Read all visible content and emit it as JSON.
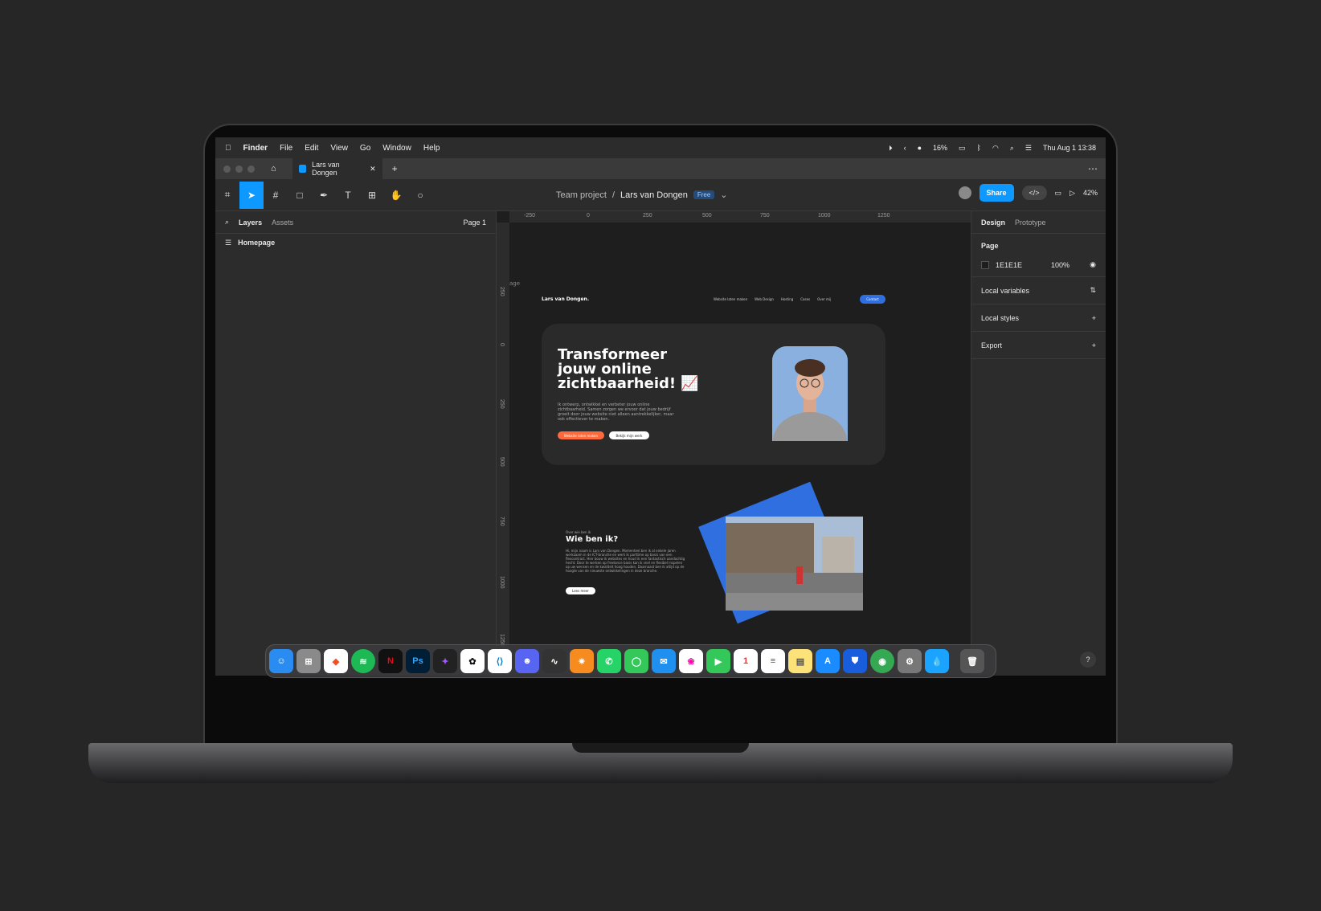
{
  "menubar": {
    "items": [
      "Finder",
      "File",
      "Edit",
      "View",
      "Go",
      "Window",
      "Help"
    ],
    "battery": "16%",
    "datetime": "Thu Aug 1  13:38"
  },
  "tabbar": {
    "tab_title": "Lars van Dongen"
  },
  "toolbar": {
    "team": "Team project",
    "file": "Lars van Dongen",
    "plan": "Free",
    "share": "Share",
    "zoom": "42%"
  },
  "left": {
    "tab_layers": "Layers",
    "tab_assets": "Assets",
    "page": "Page 1",
    "layer": "Homepage"
  },
  "right": {
    "tab_design": "Design",
    "tab_prototype": "Prototype",
    "page_label": "Page",
    "page_color": "1E1E1E",
    "page_opacity": "100%",
    "local_variables": "Local variables",
    "local_styles": "Local styles",
    "export": "Export"
  },
  "rulers": {
    "h": [
      "-250",
      "0",
      "250",
      "500",
      "750",
      "1000",
      "1250"
    ],
    "v": [
      "250",
      "0",
      "250",
      "500",
      "750",
      "1000",
      "1250"
    ]
  },
  "site": {
    "frame_label": "age",
    "logo": "Lars van Dongen.",
    "nav": [
      "Website laten maken",
      "Web Design",
      "Hosting",
      "Cases",
      "Over mij"
    ],
    "nav_cta": "Contact",
    "hero_title": "Transformeer jouw online zichtbaarheid! 📈",
    "hero_text": "Ik ontwerp, ontwikkel en verbeter jouw online zichtbaarheid. Samen zorgen we ervoor dat jouw bedrijf groeit door jouw website niet alleen aantrekkelijker, maar ook effectiever te maken.",
    "hero_btn1": "Website laten maken",
    "hero_btn2": "Bekijk mijn werk",
    "about_kicker": "Over wie ben ik",
    "about_title": "Wie ben ik?",
    "about_text": "Hi, mijn naam is Lars van Dongen. Momenteel ben ik al enkele jaren werkzaam in de ICT-branche en werk ik parttime op basis van een flexcontract. Hier bouw ik websites en houd ik een fantastisch aandachtig hecht. Door te werken op freelance basis kan ik snel en flexibel inspelen op uw wensen en de kwaliteit hoog houden. Daarnaast ben ik altijd op de hoogte van de nieuwste ontwikkelingen in deze branche.",
    "about_btn": "Lees meer"
  },
  "dock": [
    "Finder",
    "Launchpad",
    "Brave",
    "Spotify",
    "Netflix",
    "Photoshop",
    "Figma",
    "ChatGPT",
    "VS Code",
    "Discord",
    "Voice",
    "FL Studio",
    "WhatsApp",
    "Messages",
    "Mail",
    "Photos",
    "FaceTime",
    "Calendar",
    "Reminders",
    "Notes",
    "App Store",
    "Bitwarden",
    "Chrome",
    "Settings",
    "Drop",
    "Trash"
  ],
  "colors": {
    "accent": "#0d99ff",
    "orange": "#ff6a3d"
  }
}
